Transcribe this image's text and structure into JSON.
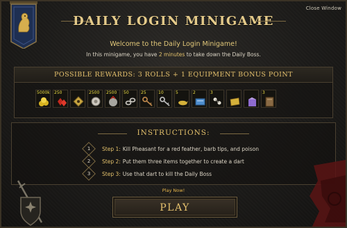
{
  "window": {
    "close_label": "Close Window",
    "title": "DAILY LOGIN MINIGAME"
  },
  "intro": {
    "welcome": "Welcome to the Daily Login Minigame!",
    "line_prefix": "In this minigame, you have ",
    "line_highlight": "2 minutes",
    "line_suffix": " to take down the Daily Boss."
  },
  "rewards": {
    "header": "POSSIBLE REWARDS: 3 ROLLS + 1 EQUIPMENT BONUS POINT",
    "items": [
      {
        "qty": "5000k",
        "icon": "gold-coins-icon",
        "color": "#d8b321"
      },
      {
        "qty": "250",
        "icon": "red-gems-icon",
        "color": "#c4281e"
      },
      {
        "qty": "",
        "icon": "compass-rune-icon",
        "color": "#c9a640"
      },
      {
        "qty": "2500",
        "icon": "silver-medallion-icon",
        "color": "#cfcac0"
      },
      {
        "qty": "2500",
        "icon": "grey-orb-icon",
        "color": "#a8a6a0"
      },
      {
        "qty": "50",
        "icon": "silver-chain-icon",
        "color": "#c0bdb7"
      },
      {
        "qty": "25",
        "icon": "bronze-key-icon",
        "color": "#b9844a"
      },
      {
        "qty": "10",
        "icon": "silver-key-icon",
        "color": "#b9b9b9"
      },
      {
        "qty": "5",
        "icon": "golden-lamp-icon",
        "color": "#d5b13a"
      },
      {
        "qty": "2",
        "icon": "blue-scroll-icon",
        "color": "#4f8fcf"
      },
      {
        "qty": "3",
        "icon": "white-charm-icon",
        "color": "#e8e4d8"
      },
      {
        "qty": "",
        "icon": "gold-ticket-icon",
        "color": "#d5b13a"
      },
      {
        "qty": "",
        "icon": "purple-box-icon",
        "color": "#8e6bcf"
      },
      {
        "qty": "3",
        "icon": "brown-book-icon",
        "color": "#8a6a44"
      }
    ]
  },
  "instructions": {
    "title": "INSTRUCTIONS:",
    "steps": [
      {
        "num": "1",
        "label": "Step 1:",
        "text": "Kill Pheasant for a red feather, barb tips, and poison"
      },
      {
        "num": "2",
        "label": "Step 2:",
        "text": "Put them three items together to create a dart"
      },
      {
        "num": "3",
        "label": "Step 3:",
        "text": "Use that dart to kill the Daily Boss"
      }
    ]
  },
  "footer": {
    "play_now": "Play Now!",
    "play_button": "PLAY"
  }
}
